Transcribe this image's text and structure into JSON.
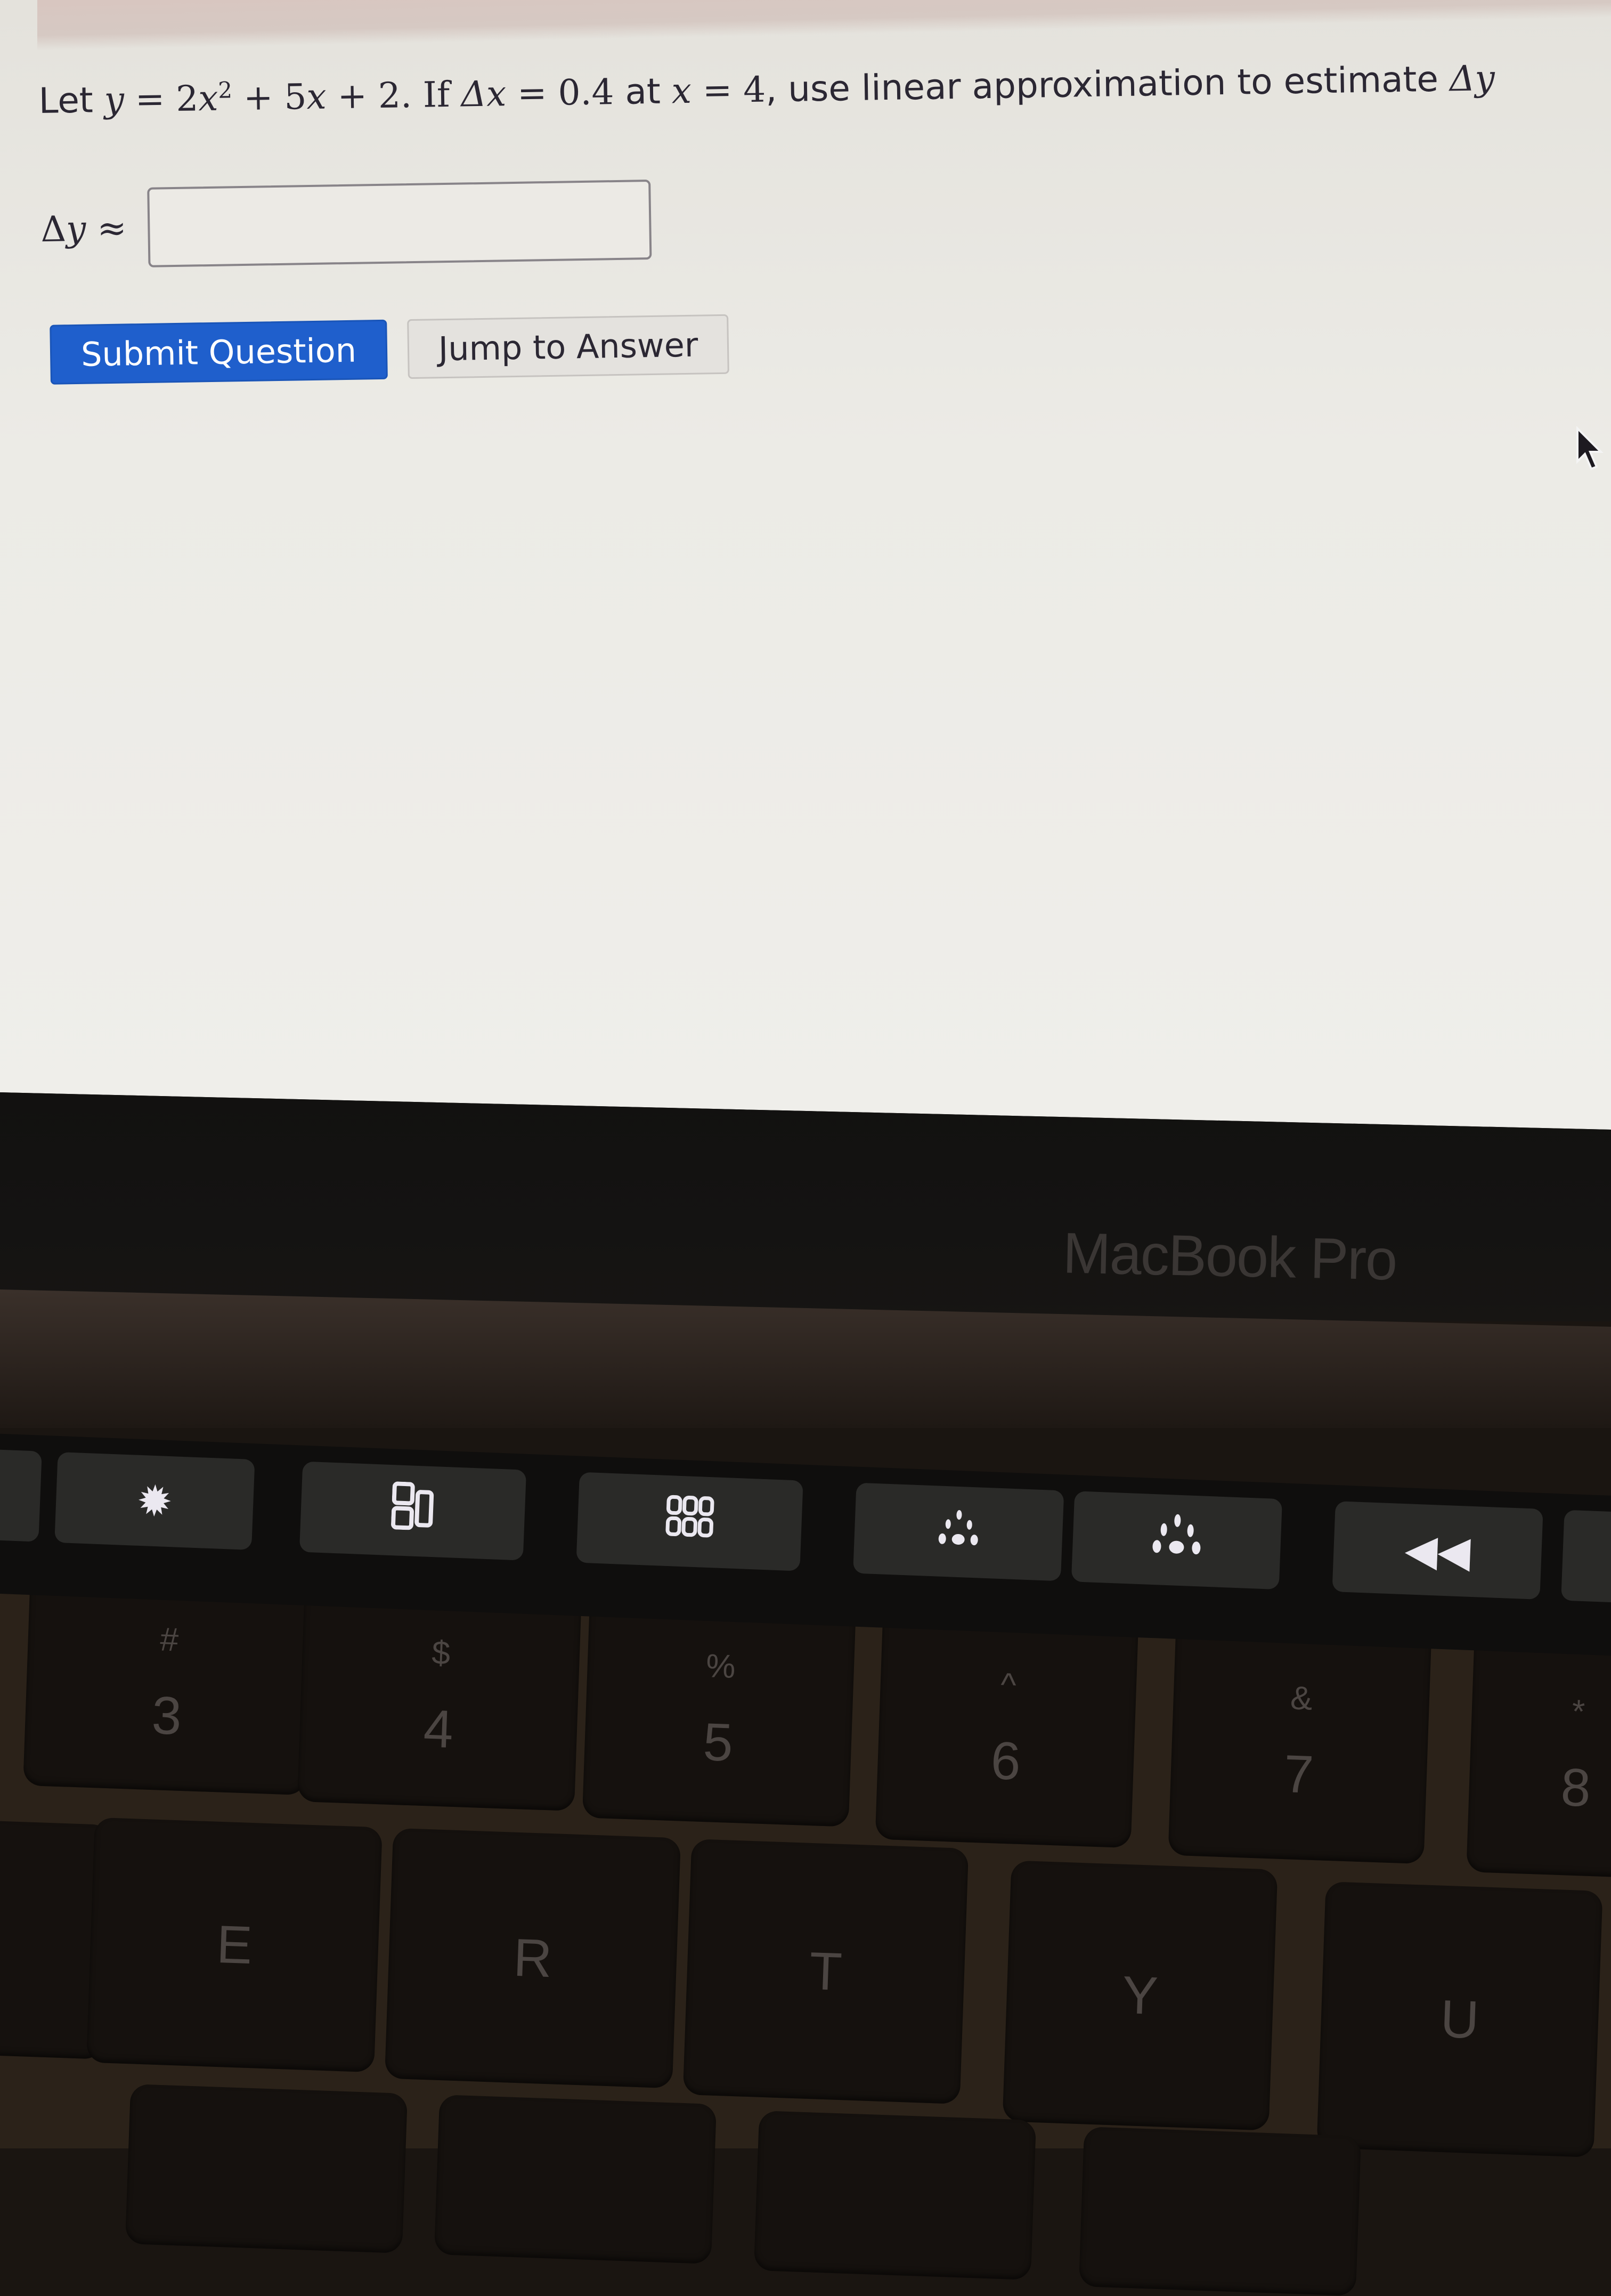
{
  "question": {
    "prefix": "Let ",
    "var_y": "y",
    "equals": " = ",
    "coef": "2",
    "var_x": "x",
    "exponent": "2",
    "term2": " + 5",
    "var_x2": "x",
    "term3": " + 2. If ",
    "delta_x": "Δx",
    "equals2": " = ",
    "delta_value": "0.4",
    "at": " at ",
    "var_x3": "x",
    "equals3": " = ",
    "x_value": "4",
    "suffix": ", use linear approximation to estimate ",
    "delta_y": "Δy"
  },
  "answer": {
    "label_delta": "Δ",
    "label_var": "y",
    "label_approx": " ≈",
    "input_value": "",
    "input_placeholder": ""
  },
  "buttons": {
    "submit_label": "Submit Question",
    "jump_label": "Jump to Answer"
  },
  "colors": {
    "primary_button": "#1f5fcc",
    "page_background": "#efeeea"
  },
  "device": {
    "brand_label": "MacBook Pro"
  },
  "touchbar": {
    "icons": [
      "brightness-up-icon",
      "mission-control-icon",
      "launchpad-icon",
      "keyboard-brightness-down-icon",
      "keyboard-brightness-up-icon",
      "rewind-icon"
    ]
  },
  "keyboard": {
    "number_row": [
      {
        "shift": "#",
        "main": "3"
      },
      {
        "shift": "$",
        "main": "4"
      },
      {
        "shift": "%",
        "main": "5"
      },
      {
        "shift": "^",
        "main": "6"
      },
      {
        "shift": "&",
        "main": "7"
      },
      {
        "shift": "*",
        "main": "8"
      }
    ],
    "letter_row": [
      "E",
      "R",
      "T",
      "Y",
      "U"
    ]
  }
}
